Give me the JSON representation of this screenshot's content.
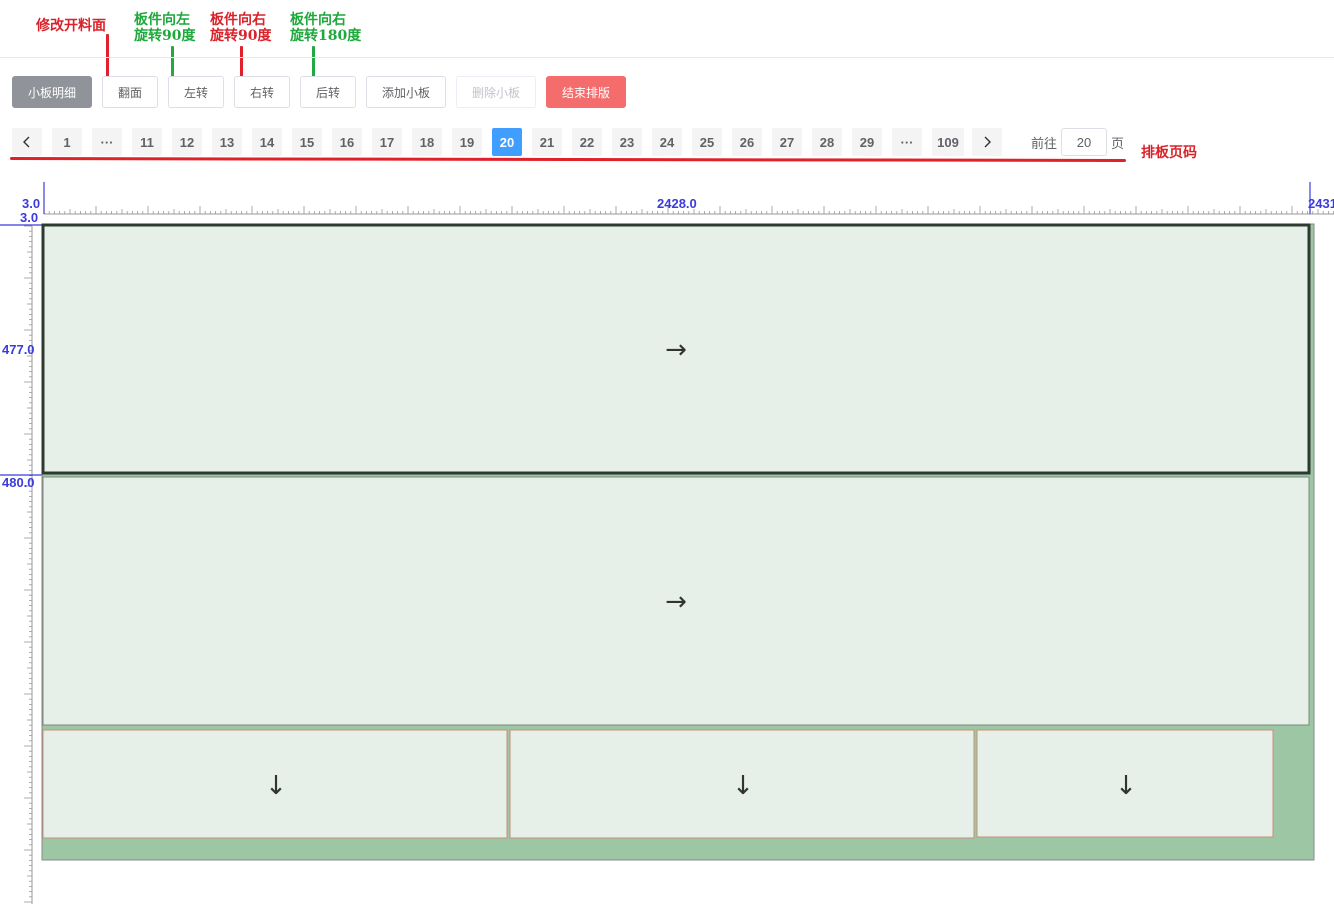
{
  "annotations": {
    "flip_face": "修改开料面",
    "rotate_left_line1": "板件向左",
    "rotate_left_line2": "旋转90度",
    "rotate_right_line1": "板件向右",
    "rotate_right_line2": "旋转90度",
    "rotate_back_line1": "板件向右",
    "rotate_back_line2": "旋转180度",
    "pagination": "排板页码"
  },
  "toolbar": {
    "detail_label": "小板明细",
    "flip_label": "翻面",
    "rotate_left_label": "左转",
    "rotate_right_label": "右转",
    "rotate_back_label": "后转",
    "add_label": "添加小板",
    "delete_label": "删除小板",
    "finish_label": "结束排版"
  },
  "pagination": {
    "prev_icon": "chevron-left-icon",
    "next_icon": "chevron-right-icon",
    "pages": [
      "1",
      "···",
      "11",
      "12",
      "13",
      "14",
      "15",
      "16",
      "17",
      "18",
      "19",
      "20",
      "21",
      "22",
      "23",
      "24",
      "25",
      "26",
      "27",
      "28",
      "29",
      "···",
      "109"
    ],
    "current": "20",
    "goto_prefix": "前往",
    "goto_value": "20",
    "goto_suffix": "页"
  },
  "ruler": {
    "top_start": "3.0",
    "top_mid": "2428.0",
    "top_end": "2431",
    "left_start": "3.0",
    "left_mid1": "477.0",
    "left_mid2": "480.0"
  },
  "board": {
    "arrow_right": "→",
    "arrow_down": "↓"
  },
  "colors": {
    "accent": "#409eff",
    "danger": "#f56c6c",
    "info": "#909399",
    "board_fill": "#9cc6a4",
    "panel_fill": "#e6f0e8",
    "ruler": "#3b3bdc",
    "annotation_red": "#d9232b",
    "annotation_green": "#1fa83b"
  }
}
